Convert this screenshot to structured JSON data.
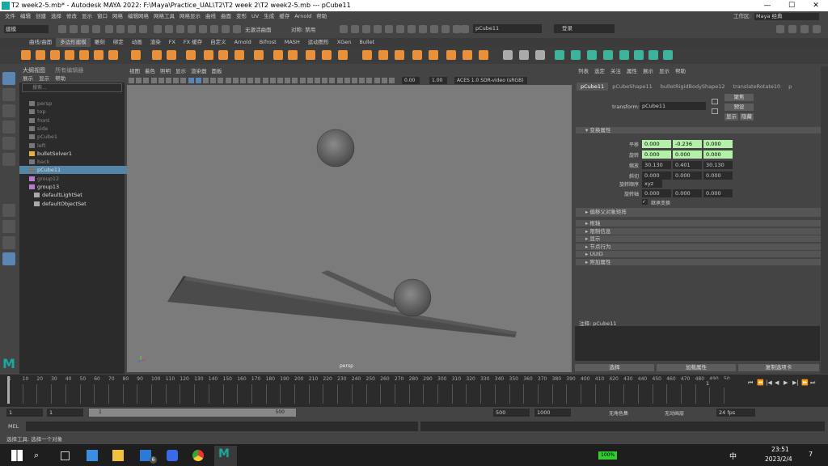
{
  "window": {
    "title": "T2 week2-5.mb* - Autodesk MAYA 2022: F:\\Maya\\Practice_UAL\\T2\\T2 week 2\\T2 week2-5.mb  ---  pCube11",
    "minimize": "—",
    "maximize": "☐",
    "close": "✕"
  },
  "menubar": {
    "items": [
      "文件",
      "编辑",
      "创建",
      "选择",
      "修改",
      "显示",
      "窗口",
      "网格",
      "编辑网格",
      "网格工具",
      "网格显示",
      "曲线",
      "曲面",
      "变形",
      "UV",
      "生成",
      "缓存",
      "Arnold",
      "帮助"
    ],
    "workspace_label": "工作区:",
    "workspace_value": "Maya 经典"
  },
  "statusline": {
    "mode": "建模",
    "no_live": "无激活曲面",
    "symmetry": "对称: 禁用",
    "name_field": "pCube11",
    "login": "登录"
  },
  "shelf": {
    "tabs": [
      "曲线/曲面",
      "多边形建模",
      "雕刻",
      "绑定",
      "动画",
      "渲染",
      "FX",
      "FX 缓存",
      "自定义",
      "Arnold",
      "Bifrost",
      "MASH",
      "运动图形",
      "XGen",
      "Bullet"
    ],
    "selected": 1
  },
  "outliner": {
    "title": "大纲视图",
    "tab2": "所有编辑器",
    "menus": [
      "展示",
      "显示",
      "帮助"
    ],
    "search_placeholder": "搜索...",
    "items": [
      "persp",
      "top",
      "front",
      "side",
      "pCube1",
      "left",
      "bulletSolver1",
      "back",
      "pCube11",
      "group12",
      "group13",
      "defaultLightSet",
      "defaultObjectSet"
    ],
    "selected": "pCube11"
  },
  "viewport": {
    "menus": [
      "视图",
      "着色",
      "照明",
      "显示",
      "渲染器",
      "面板"
    ],
    "exposure": "0.00",
    "gamma": "1.00",
    "color_space": "ACES 1.0 SDR-video (sRGB)",
    "camera_label": "persp"
  },
  "attribute_editor": {
    "menus": [
      "列表",
      "选定",
      "关注",
      "属性",
      "展示",
      "显示",
      "帮助"
    ],
    "tabs": [
      "pCube11",
      "pCubeShape11",
      "bulletRigidBodyShape12",
      "translateRotate10",
      "p"
    ],
    "transform_label": "transform:",
    "transform_value": "pCube11",
    "focus_btn": "聚焦",
    "presets_btn": "预设",
    "show_btn": "显示",
    "hide_btn": "隐藏",
    "section_transform": "变换属性",
    "translate_label": "平移",
    "translate": [
      "0.000",
      "-0.236",
      "0.000"
    ],
    "rotate_label": "旋转",
    "rotate": [
      "0.000",
      "0.000",
      "0.000"
    ],
    "scale_label": "缩放",
    "scale": [
      "30.130",
      "0.401",
      "30.130"
    ],
    "shear_label": "斜切",
    "shear": [
      "0.000",
      "0.000",
      "0.000"
    ],
    "rotate_order_label": "旋转顺序",
    "rotate_order": "xyz",
    "rotate_axis_label": "旋转轴",
    "rotate_axis": [
      "0.000",
      "0.000",
      "0.000"
    ],
    "inherits_label": "继承变换",
    "section_parent": "偏移父对象矩阵",
    "sections": [
      "枢轴",
      "限制信息",
      "显示",
      "节点行为",
      "UUID",
      "附加属性"
    ],
    "notes_label": "注释:  pCube11",
    "btn_select": "选择",
    "btn_load": "加载属性",
    "btn_copy": "复制选项卡"
  },
  "timeline": {
    "ticks": [
      "1",
      "10",
      "20",
      "30",
      "40",
      "50",
      "60",
      "70",
      "80",
      "90",
      "100",
      "110",
      "120",
      "130",
      "140",
      "150",
      "160",
      "170",
      "180",
      "190",
      "200",
      "210",
      "220",
      "230",
      "240",
      "250",
      "260",
      "270",
      "280",
      "290",
      "300",
      "310",
      "320",
      "330",
      "340",
      "350",
      "360",
      "370",
      "380",
      "390",
      "400",
      "410",
      "420",
      "430",
      "440",
      "450",
      "460",
      "470",
      "480",
      "490",
      "50"
    ],
    "current_frame": "1"
  },
  "range": {
    "start": "1",
    "start2": "1",
    "slider_start": "1",
    "slider_end": "500",
    "end": "500",
    "end2": "1000",
    "character": "无角色集",
    "anim_layer": "无动画层",
    "fps": "24 fps"
  },
  "cmdline": {
    "label": "MEL"
  },
  "helpline": {
    "text": "选择工具: 选择一个对象"
  },
  "taskbar": {
    "battery": "100%",
    "ime": "中",
    "time": "23:51",
    "date": "2023/2/4",
    "mail_badge": "6",
    "notif": "7"
  }
}
